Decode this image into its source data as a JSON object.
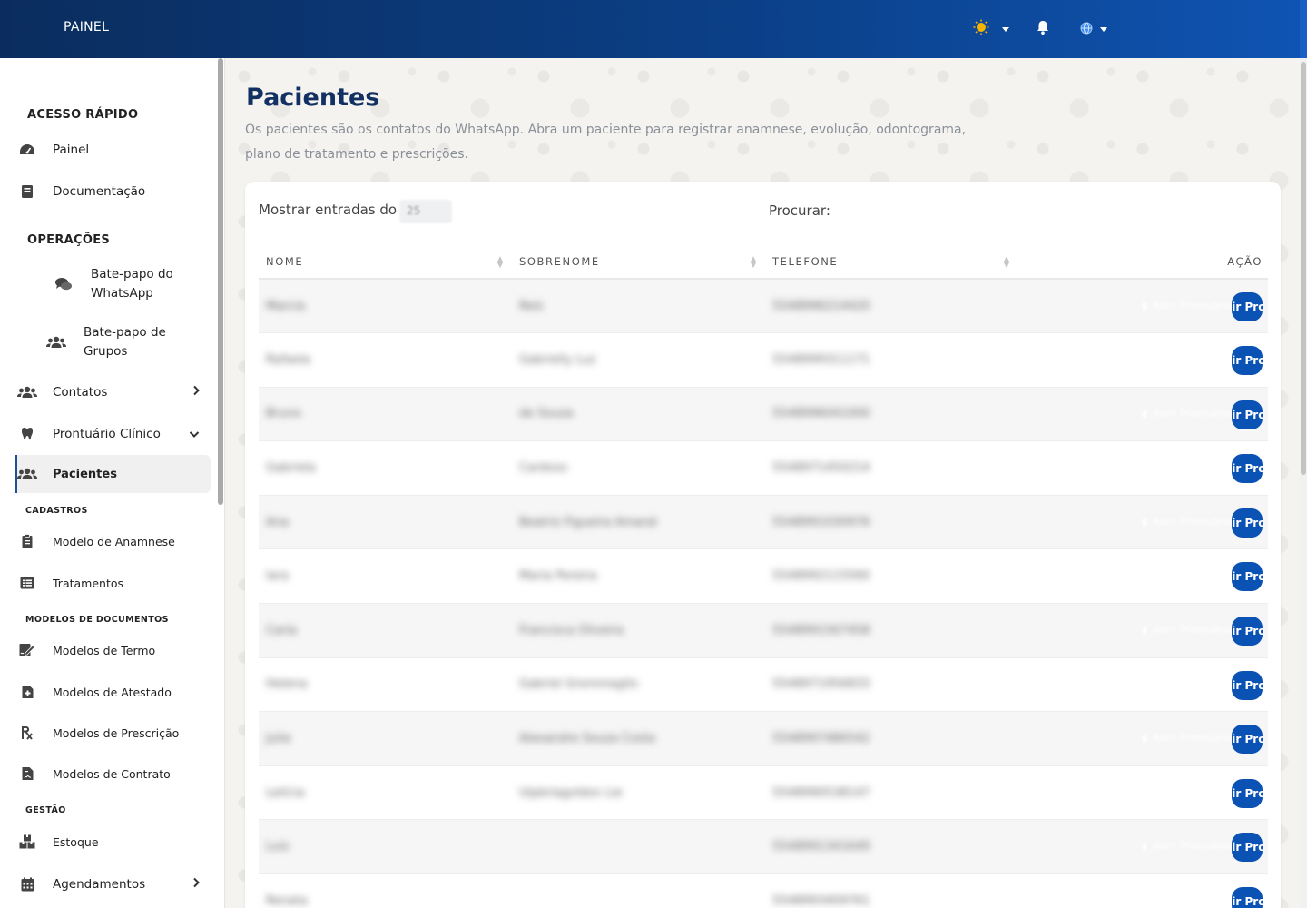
{
  "header": {
    "brand": "PAINEL",
    "theme_icon": "sun-icon",
    "notification_icon": "bell-icon",
    "language_icon": "globe-icon"
  },
  "sidebar": {
    "sections": [
      {
        "title": "ACESSO RÁPIDO"
      },
      {
        "title": "OPERAÇÕES"
      }
    ],
    "quick": [
      {
        "label": "Painel",
        "icon": "dashboard-icon"
      },
      {
        "label": "Documentação",
        "icon": "book-icon"
      }
    ],
    "ops": [
      {
        "line1": "Bate-papo do",
        "line2": "WhatsApp",
        "icon": "chat-icon"
      },
      {
        "line1": "Bate-papo de",
        "line2": "Grupos",
        "icon": "users-icon"
      },
      {
        "label": "Contatos",
        "icon": "users-icon"
      },
      {
        "label": "Prontuário Clínico",
        "icon": "tooth-icon"
      },
      {
        "label": "Pacientes",
        "icon": "users-icon"
      }
    ],
    "subsections": [
      "CADASTROS",
      "MODELOS DE DOCUMENTOS",
      "GESTÃO"
    ],
    "cadastros": [
      {
        "label": "Modelo de Anamnese",
        "icon": "clipboard-icon"
      },
      {
        "label": "Tratamentos",
        "icon": "list-icon"
      }
    ],
    "modelos": [
      {
        "label": "Modelos de Termo",
        "icon": "signature-icon"
      },
      {
        "label": "Modelos de Atestado",
        "icon": "file-medical-icon"
      },
      {
        "label": "Modelos de Prescrição",
        "icon": "prescription-icon"
      },
      {
        "label": "Modelos de Contrato",
        "icon": "file-contract-icon"
      }
    ],
    "gestao": [
      {
        "label": "Estoque",
        "icon": "boxes-icon"
      },
      {
        "label": "Agendamentos",
        "icon": "calendar-icon"
      }
    ]
  },
  "page": {
    "title": "Pacientes",
    "description": "Os pacientes são os contatos do WhatsApp. Abra um paciente para registrar anamnese, evolução, odontograma, plano de tratamento e prescrições."
  },
  "table": {
    "length_label": "Mostrar entradas do",
    "length_value": "25",
    "search_label": "Procurar:",
    "columns": [
      "NOME",
      "SOBRENOME",
      "TELEFONE",
      "AÇÃO"
    ],
    "action_label": "Abrir Prontuário",
    "action_peek": "ir Pron",
    "rows": [
      {
        "nome": "Marcia",
        "sobrenome": "Reis",
        "telefone": "5548996214420"
      },
      {
        "nome": "Rafaela",
        "sobrenome": "Gabrielly Luz",
        "telefone": "5548999311171"
      },
      {
        "nome": "Bruno",
        "sobrenome": "de Souza",
        "telefone": "5548996041000"
      },
      {
        "nome": "Gabriela",
        "sobrenome": "Cardoso",
        "telefone": "5548971450214"
      },
      {
        "nome": "Ana",
        "sobrenome": "Beatriz Figueira Amaral",
        "telefone": "5548991030976"
      },
      {
        "nome": "Iara",
        "sobrenome": "Maria Pereira",
        "telefone": "5548992115560"
      },
      {
        "nome": "Carla",
        "sobrenome": "Francisca Oliveira",
        "telefone": "5548991567458"
      },
      {
        "nome": "Helena",
        "sobrenome": "Gabriel Grommaglio",
        "telefone": "5548971956833"
      },
      {
        "nome": "Julia",
        "sobrenome": "Alexandre Souza Costa",
        "telefone": "5548997486542"
      },
      {
        "nome": "Letícia",
        "sobrenome": "Uipbriagoldon Lie",
        "telefone": "5548990538147"
      },
      {
        "nome": "Luis",
        "sobrenome": "",
        "telefone": "5548991341649"
      },
      {
        "nome": "Renata",
        "sobrenome": "",
        "telefone": "5548993409761"
      }
    ]
  },
  "colors": {
    "primary": "#0b52b5",
    "title": "#123062",
    "header_start": "#0b2d5e",
    "header_end": "#0f54b3"
  }
}
